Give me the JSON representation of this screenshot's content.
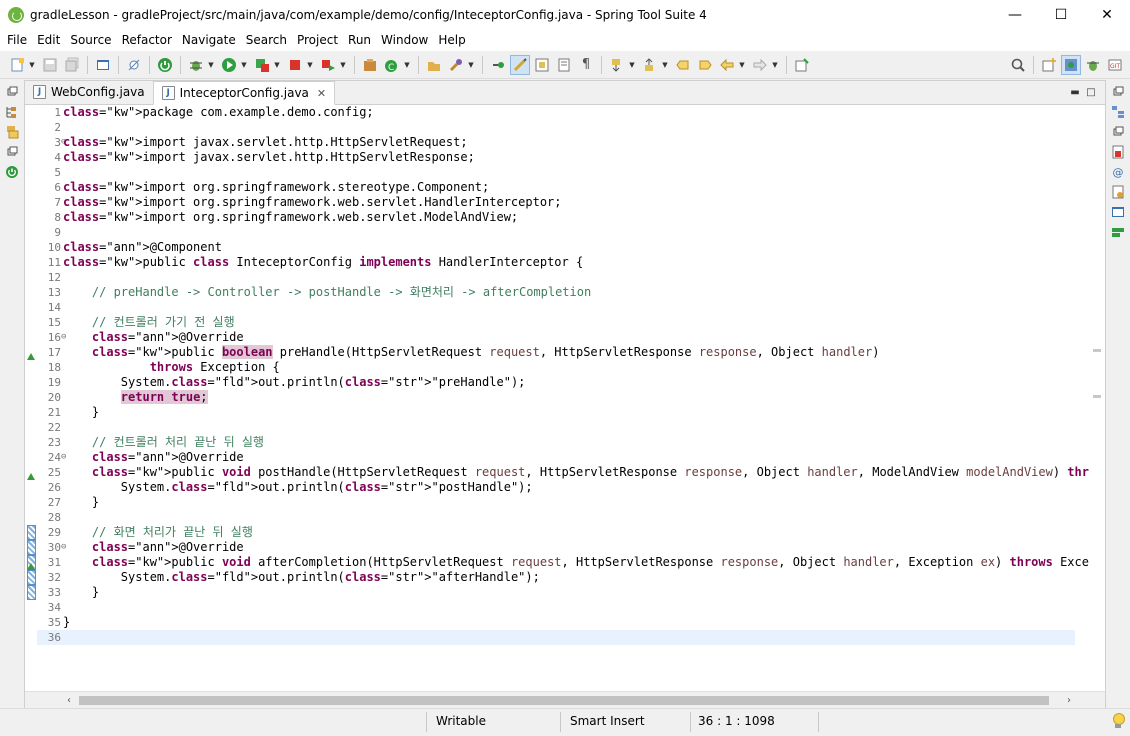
{
  "window": {
    "title": "gradleLesson - gradleProject/src/main/java/com/example/demo/config/InteceptorConfig.java - Spring Tool Suite 4",
    "minimize": "—",
    "maximize": "☐",
    "close": "✕"
  },
  "menu": [
    "File",
    "Edit",
    "Source",
    "Refactor",
    "Navigate",
    "Search",
    "Project",
    "Run",
    "Window",
    "Help"
  ],
  "tabs": [
    {
      "label": "WebConfig.java",
      "icon": "J"
    },
    {
      "label": "InteceptorConfig.java",
      "icon": "J",
      "close": "✕"
    }
  ],
  "editor_controls": {
    "minimize": "▬",
    "maximize": "□"
  },
  "code": {
    "line_numbers": [
      "1",
      "2",
      "3",
      "4",
      "5",
      "6",
      "7",
      "8",
      "9",
      "10",
      "11",
      "12",
      "13",
      "14",
      "15",
      "16",
      "17",
      "18",
      "19",
      "20",
      "21",
      "22",
      "23",
      "24",
      "25",
      "26",
      "27",
      "28",
      "29",
      "30",
      "31",
      "32",
      "33",
      "34",
      "35",
      "36"
    ],
    "lines": [
      {
        "t": "package com.example.demo.config;"
      },
      {
        "t": ""
      },
      {
        "t": "import javax.servlet.http.HttpServletRequest;"
      },
      {
        "t": "import javax.servlet.http.HttpServletResponse;"
      },
      {
        "t": ""
      },
      {
        "t": "import org.springframework.stereotype.Component;"
      },
      {
        "t": "import org.springframework.web.servlet.HandlerInterceptor;"
      },
      {
        "t": "import org.springframework.web.servlet.ModelAndView;"
      },
      {
        "t": ""
      },
      {
        "t": "@Component"
      },
      {
        "t": "public class InteceptorConfig implements HandlerInterceptor {"
      },
      {
        "t": ""
      },
      {
        "t": "    // preHandle -> Controller -> postHandle -> 화면처리 -> afterCompletion"
      },
      {
        "t": ""
      },
      {
        "t": "    // 컨트롤러 가기 전 실행"
      },
      {
        "t": "    @Override"
      },
      {
        "t": "    public boolean preHandle(HttpServletRequest request, HttpServletResponse response, Object handler)"
      },
      {
        "t": "            throws Exception {"
      },
      {
        "t": "        System.out.println(\"preHandle\");"
      },
      {
        "t": "        return true;"
      },
      {
        "t": "    }"
      },
      {
        "t": ""
      },
      {
        "t": "    // 컨트롤러 처리 끝난 뒤 실행"
      },
      {
        "t": "    @Override"
      },
      {
        "t": "    public void postHandle(HttpServletRequest request, HttpServletResponse response, Object handler, ModelAndView modelAndView) throws Exception"
      },
      {
        "t": "        System.out.println(\"postHandle\");"
      },
      {
        "t": "    }"
      },
      {
        "t": ""
      },
      {
        "t": "    // 화면 처리가 끝난 뒤 실행"
      },
      {
        "t": "    @Override"
      },
      {
        "t": "    public void afterCompletion(HttpServletRequest request, HttpServletResponse response, Object handler, Exception ex) throws Exception {"
      },
      {
        "t": "        System.out.println(\"afterHandle\");"
      },
      {
        "t": "    }"
      },
      {
        "t": ""
      },
      {
        "t": "}"
      },
      {
        "t": ""
      }
    ]
  },
  "status": {
    "writable": "Writable",
    "insert_mode": "Smart Insert",
    "position": "36 : 1 : 1098"
  },
  "icons": {
    "search": "🔍",
    "scroll_left": "‹",
    "scroll_right": "›"
  }
}
